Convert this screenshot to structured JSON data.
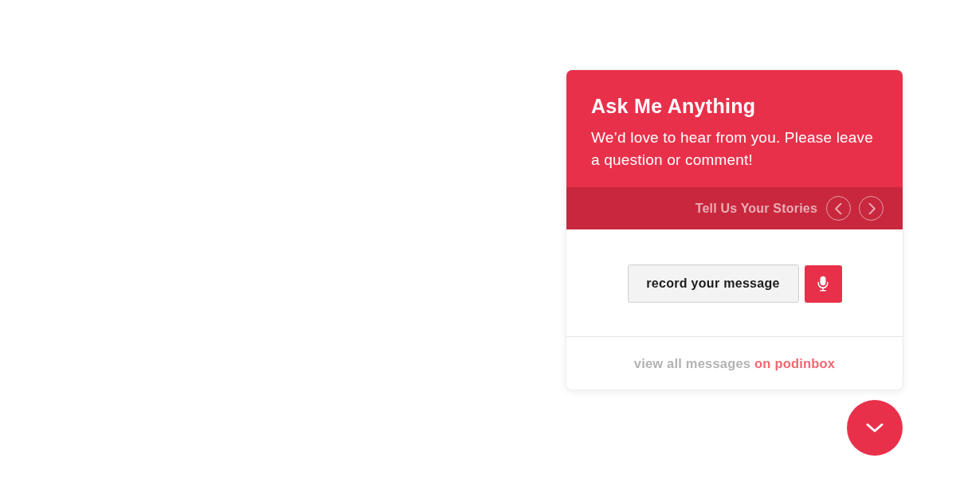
{
  "widget": {
    "title": "Ask Me Anything",
    "subtitle": "We’d love to hear from you. Please leave a question or comment!"
  },
  "stories_bar": {
    "label": "Tell Us Your Stories"
  },
  "record": {
    "button": "record your message"
  },
  "footer": {
    "text": "view all messages",
    "link": "on podinbox"
  },
  "toggle": {
    "expanded": true
  }
}
